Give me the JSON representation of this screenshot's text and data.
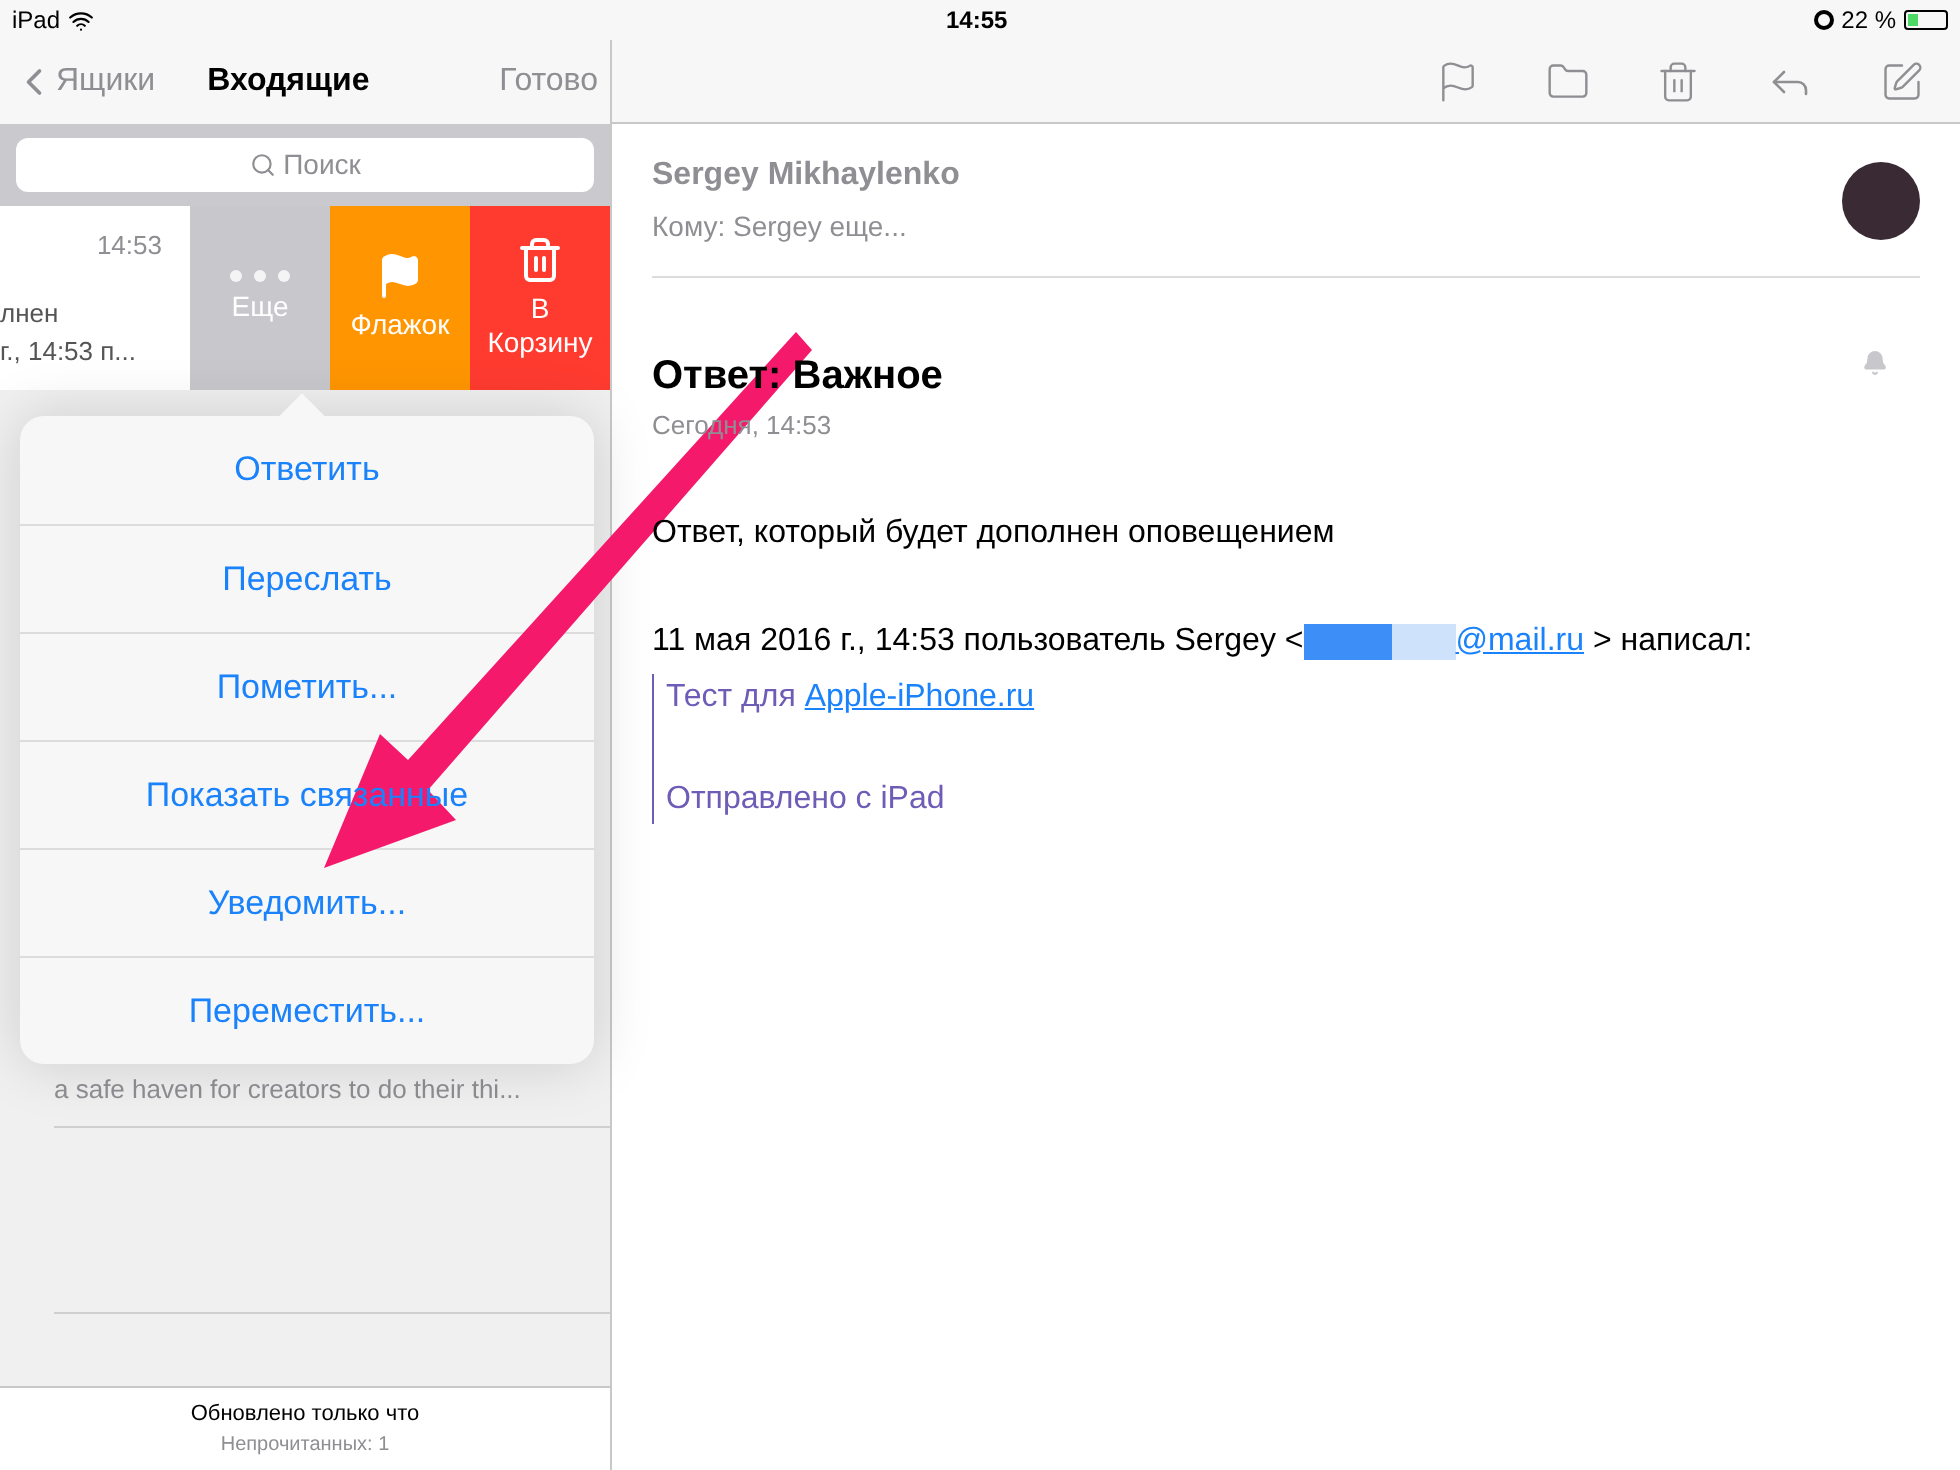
{
  "status_bar": {
    "device": "iPad",
    "time": "14:55",
    "battery": "22 %"
  },
  "sidebar": {
    "back": "Ящики",
    "title": "Входящие",
    "done": "Готово",
    "search": {
      "placeholder": "Поиск"
    },
    "swiped_row": {
      "time": "14:53",
      "line_1": "лнен",
      "line_2": "г., 14:53 п..."
    },
    "swipe_actions": [
      {
        "kind": "more",
        "label": "Еще"
      },
      {
        "kind": "flag",
        "label": "Флажок"
      },
      {
        "kind": "trash",
        "label": "В Корзину"
      }
    ],
    "menu": [
      "Ответить",
      "Переслать",
      "Пометить...",
      "Показать связанные",
      "Уведомить...",
      "Переместить..."
    ],
    "preview": "a safe haven for creators to do their thi...",
    "footer": {
      "updated": "Обновлено только что",
      "unread": "Непрочитанных: 1"
    }
  },
  "message": {
    "sender": "Sergey Mikhaylenko",
    "to": "Кому: Sergey еще...",
    "subject": "Ответ: Важное",
    "date": "Сегодня, 14:53",
    "notify": true,
    "body": "Ответ, который будет дополнен оповещением",
    "quote_intro": "11 мая 2016 г., 14:53 пользователь Sergey <",
    "quote_email": "@mail.ru",
    "quote_outro": "> написал:",
    "quote_text": "Тест для ",
    "quote_link": "Apple-iPhone.ru",
    "signature": "Отправлено с iPad"
  }
}
